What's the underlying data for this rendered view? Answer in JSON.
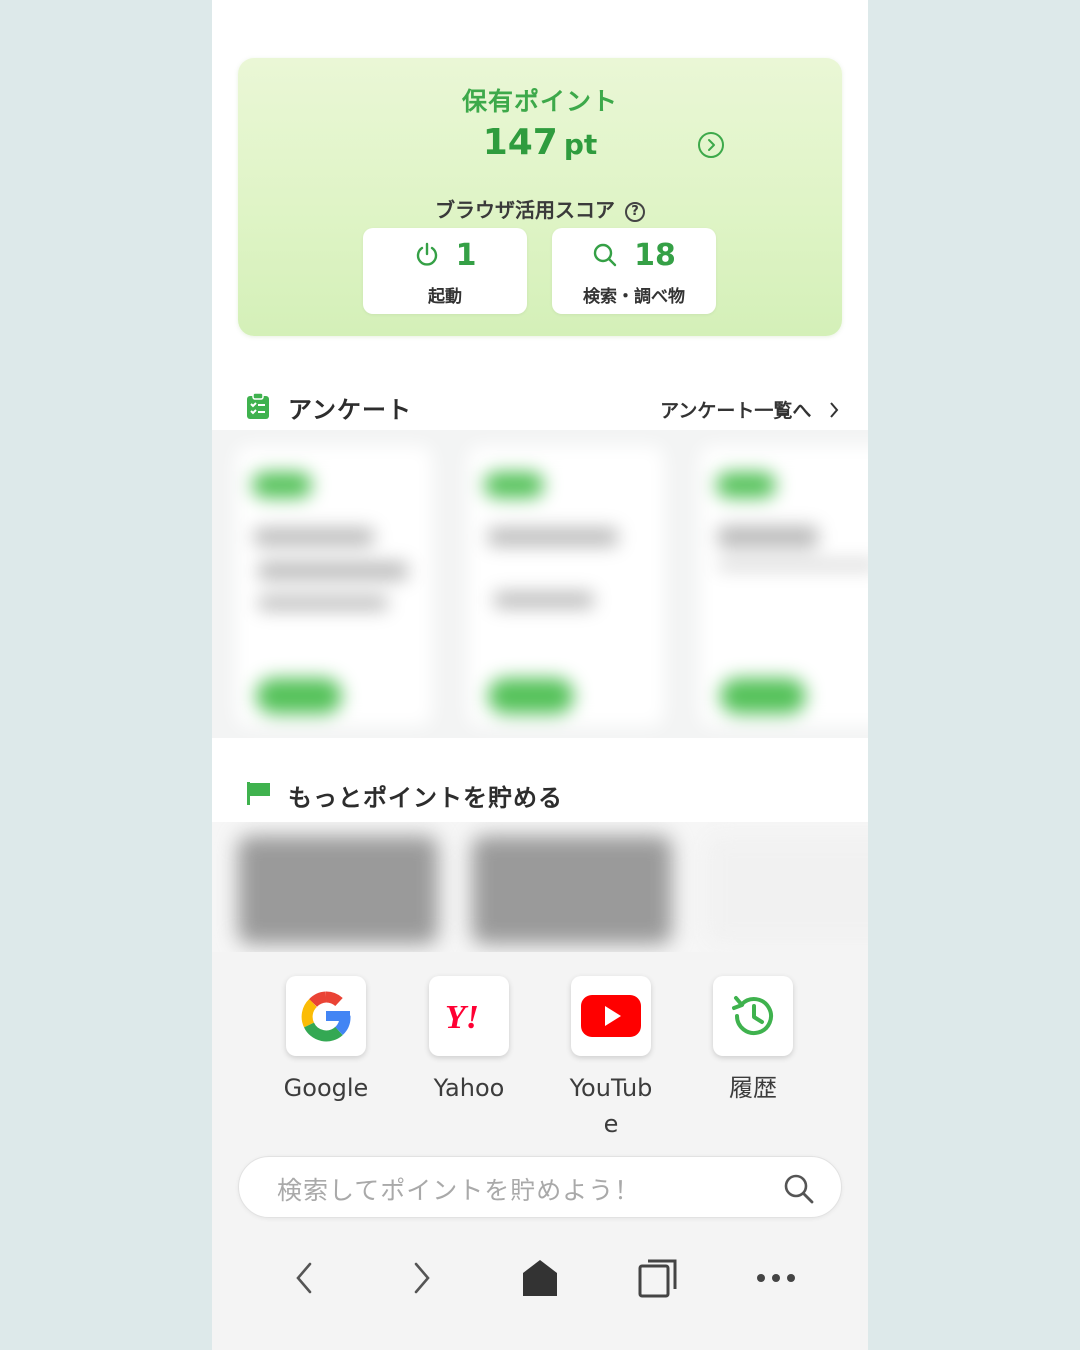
{
  "points": {
    "label": "保有ポイント",
    "value": "147",
    "unit": "pt"
  },
  "score": {
    "label": "ブラウザ活用スコア",
    "help": "?",
    "launch_count": "1",
    "launch_label": "起動",
    "search_count": "18",
    "search_label": "検索・調べ物"
  },
  "survey": {
    "title": "アンケート",
    "link": "アンケート一覧へ"
  },
  "more": {
    "title": "もっとポイントを貯める"
  },
  "shortcuts": [
    {
      "label": "Google",
      "icon": "google-icon"
    },
    {
      "label": "Yahoo",
      "icon": "yahoo-icon"
    },
    {
      "label": "YouTube",
      "icon": "youtube-icon"
    },
    {
      "label": "履歴",
      "icon": "history-icon"
    }
  ],
  "search": {
    "placeholder": "検索してポイントを貯めよう！"
  },
  "colors": {
    "accent_green": "#3da94a",
    "background": "#dde9ea",
    "youtube_red": "#ff0000",
    "yahoo_red": "#ff0033"
  }
}
